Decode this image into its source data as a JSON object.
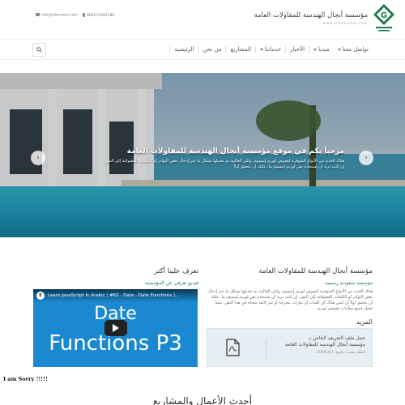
{
  "header": {
    "email": "info@sitename.com",
    "phone": "966512345789",
    "brand_name": "مؤسسة أنجال الهندسة للمقاولات العامة",
    "brand_url": "www.sitename.com"
  },
  "nav": {
    "items": [
      {
        "label": "الرئيسية",
        "dropdown": false
      },
      {
        "label": "من نحن",
        "dropdown": false
      },
      {
        "label": "المشاريع",
        "dropdown": false
      },
      {
        "label": "خدماتنا",
        "dropdown": true
      },
      {
        "label": "الأخبار",
        "dropdown": false
      },
      {
        "label": "ميديا",
        "dropdown": true
      },
      {
        "label": "تواصل معنا",
        "dropdown": true
      }
    ]
  },
  "hero": {
    "title": "مرحباً بكم في موقع مؤسسة أنجال الهندسة للمقاولات العامة",
    "description": "هناك العديد من الأنواع المتوفرة لنصوص لوريم إيبسوم، ولكن الغالبية تم تعديلها بشكل ما عبر إدخال بعض النوادر أو الكلمات العشوائية إلى النص. إن كنت تريد أن تستخدم نص لوريم إيبسوم ما، عليك أن تتحقق أولاً",
    "prev": "‹",
    "next": "›"
  },
  "about": {
    "title": "مؤسسة أنجال الهندسة للمقاولات العامة",
    "subtitle": "مؤسسة سعودية رسمية",
    "text": "هناك العديد من الأنواع المتوفرة لنصوص لوريم إيبسوم، ولكن الغالبية تم تعديلها بشكل ما عبر إدخال بعض النوادر أو الكلمات العشوائية إلى النص. إن كنت تريد أن تستخدم نص لوريم إيبسوم ما، عليك أن تتحقق أولاً أن ليس هناك أي كلمات أو عبارات محرجة أو غير لائقة مخبأة في هذا النص. بينما تعمل جميع مولّدات نصوص لوريم",
    "more_title": "المزيد"
  },
  "file": {
    "name_line1": "حمل ملف التعريف الخاص بـ",
    "name_line2": "مؤسسة أنجال الهندسة للمقاولات العامة",
    "meta": "الملف محدث بتاريخ: 1-4-2018"
  },
  "video": {
    "title": "تعرف علينا أكثر",
    "subtitle": "فيديو تعرفي عن المؤسسة",
    "caption": "Learn JavaScript In Arabic | #62 - Date - Date Functions ]...",
    "avatar": "E",
    "line1": "Date",
    "line2": "Functions P3"
  },
  "overlay_text": "I am Sorry !!!!!",
  "section_title": "أحدث الأعمال والمشاريع",
  "colors": {
    "accent_green": "#1a7a4c",
    "video_blue": "#1b89d1"
  }
}
